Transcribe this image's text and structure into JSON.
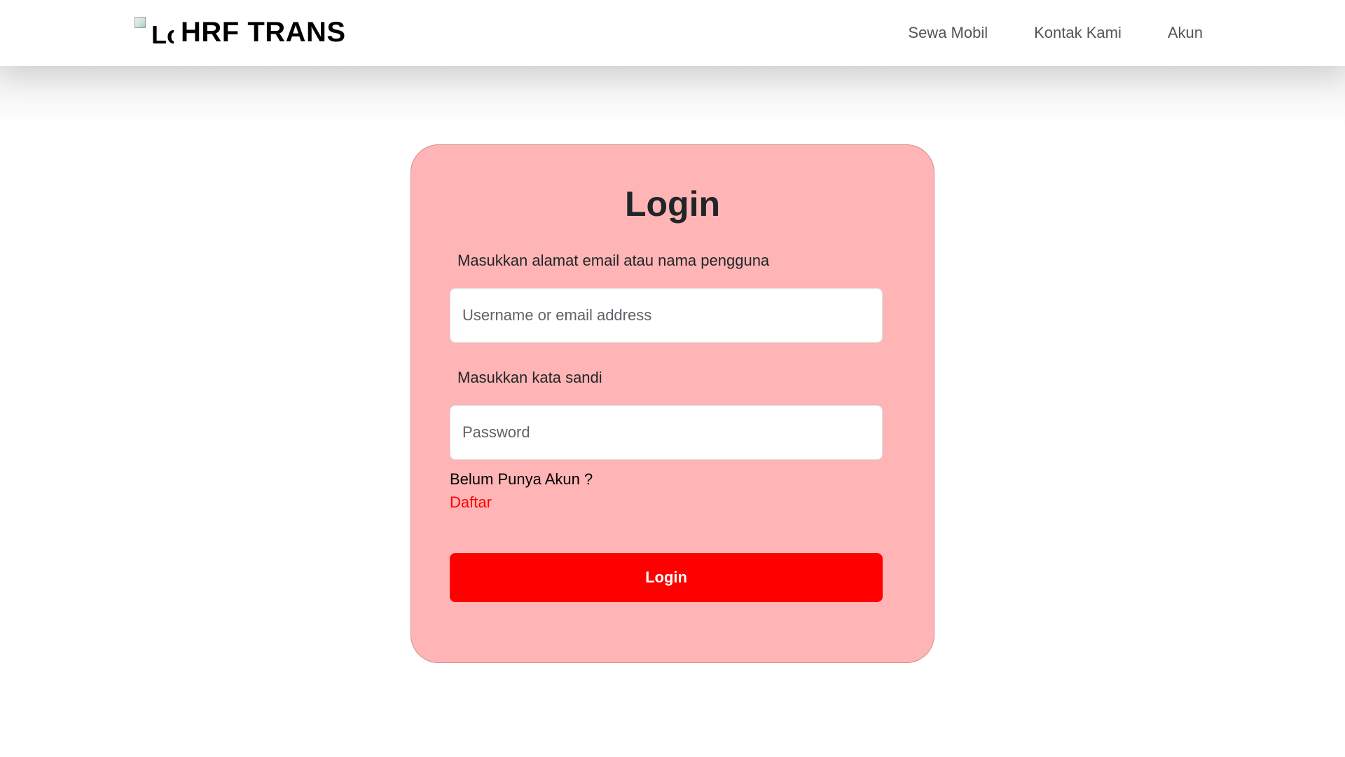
{
  "navbar": {
    "logo_alt": "Logo",
    "brand": "HRF TRANS",
    "links": [
      {
        "label": "Sewa Mobil"
      },
      {
        "label": "Kontak Kami"
      },
      {
        "label": "Akun"
      }
    ]
  },
  "login_card": {
    "title": "Login",
    "email_label": "Masukkan alamat email atau nama pengguna",
    "email_placeholder": "Username or email address",
    "password_label": "Masukkan kata sandi",
    "password_placeholder": "Password",
    "no_account_text": "Belum Punya Akun ?",
    "register_link": "Daftar",
    "submit_label": "Login"
  },
  "colors": {
    "card_background": "#ffb5b5",
    "primary_button": "#ff0000",
    "register_link": "#ff0000"
  }
}
